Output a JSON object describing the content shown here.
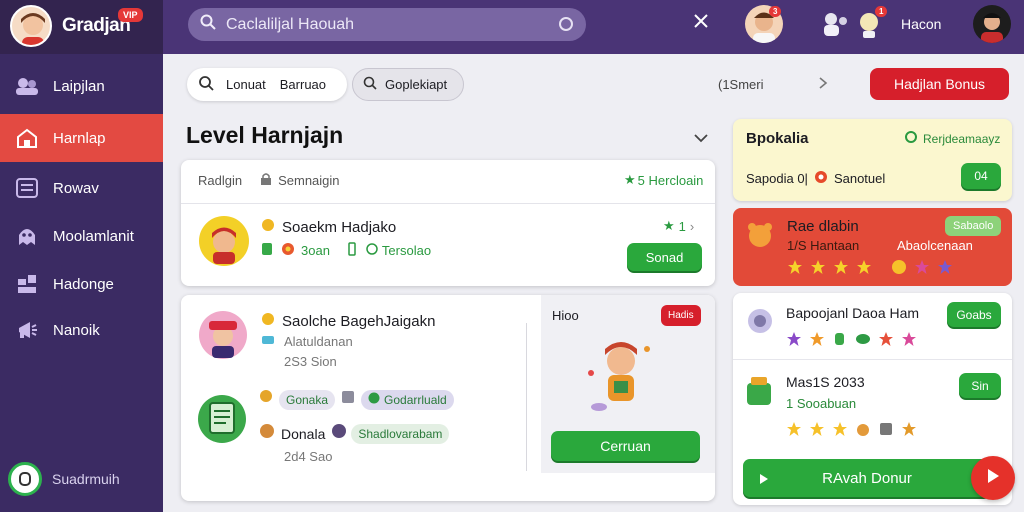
{
  "app": {
    "name": "Gradjan",
    "badge": "VIP"
  },
  "sidebar": {
    "items": [
      {
        "label": "Laipjlan",
        "icon": "users-icon"
      },
      {
        "label": "Harnlap",
        "icon": "home-icon"
      },
      {
        "label": "Rowav",
        "icon": "list-icon"
      },
      {
        "label": "Moolamlanit",
        "icon": "ghost-icon"
      },
      {
        "label": "Hadonge",
        "icon": "puzzle-icon"
      },
      {
        "label": "Nanoik",
        "icon": "megaphone-icon"
      }
    ],
    "footer_label": "Suadrmuih"
  },
  "topbar": {
    "search_placeholder": "Caclaliljal Haouah",
    "user_name": "Hacon",
    "notif_count_1": "3",
    "notif_count_2": "1"
  },
  "toolbar": {
    "search_label": "Lonuat",
    "search_value": "Barruao",
    "filter_label": "Goplekiapt",
    "count_label": "(1Smeri",
    "bonus_button": "Hadjlan Bonus"
  },
  "main": {
    "section_title": "Level Harnjajn",
    "header_card": {
      "left": "Radlgin",
      "middle": "Semnaigin",
      "right": "5 Hercloain"
    },
    "card1": {
      "title": "Soaekm Hadjako",
      "meta_a": "3oan",
      "meta_b": "Tersolao",
      "rating": "1",
      "button": "Sonad"
    },
    "card2": {
      "title": "Saolche BagehJaigakn",
      "subtitle": "Alatuldanan",
      "time": "2S3 Sion",
      "chip1": "Gonaka",
      "chip2": "Godarrluald",
      "row2_title": "Donala",
      "chip3": "Shadlovarabam",
      "row2_time": "2d4 Sao",
      "preview_label": "Hioo",
      "preview_badge": "Hadis",
      "preview_button": "Cerruan"
    }
  },
  "right": {
    "panel1": {
      "title": "Bpokalia",
      "tag": "Rerjdeamaayz",
      "row": "Sapodia 0|",
      "row_b": "Sanotuel",
      "button": "04"
    },
    "panel2": {
      "title": "Rae dlabin",
      "sub": "1/S Hantaan",
      "tag": "Sabaolo",
      "extra": "Abaolcenaan"
    },
    "panel3": {
      "item1_title": "Bapoojanl Daoa Ham",
      "item1_button": "Goabs",
      "item2_title": "Mas1S 2033",
      "item2_sub": "1 Sooabuan",
      "item2_button": "Sin",
      "play_button": "RAvah Donur"
    }
  },
  "colors": {
    "sidebar": "#3b2b63",
    "active": "#e34a42",
    "green": "#2aa83c",
    "red": "#d61f2b"
  }
}
